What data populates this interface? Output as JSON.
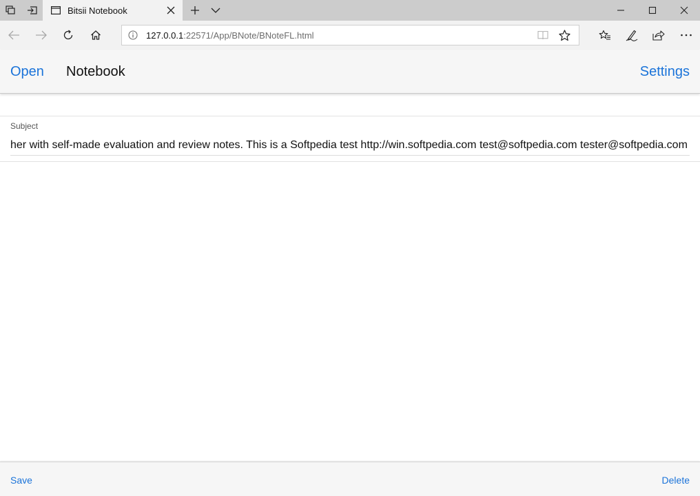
{
  "browser": {
    "tab": {
      "title": "Bitsii Notebook"
    },
    "address": {
      "url_host": "127.0.0.1",
      "url_rest": ":22571/App/BNote/BNoteFL.html"
    },
    "icons": [
      "tab-set-aside-icon",
      "tab-preview-icon",
      "page-icon",
      "close-icon",
      "plus-icon",
      "chevron-down-icon",
      "minimize-icon",
      "maximize-icon",
      "close-window-icon",
      "back-arrow-icon",
      "forward-arrow-icon",
      "refresh-icon",
      "home-icon",
      "info-icon",
      "reading-view-icon",
      "star-icon",
      "favorites-icon",
      "pen-icon",
      "share-icon",
      "more-icon"
    ]
  },
  "app": {
    "header": {
      "open_label": "Open",
      "title": "Notebook",
      "settings_label": "Settings"
    },
    "subject": {
      "label": "Subject",
      "value": "her with self-made evaluation and review notes. This is a Softpedia test http://win.softpedia.com test@softpedia.com tester@softpedia.com"
    },
    "footer": {
      "save_label": "Save",
      "delete_label": "Delete"
    }
  },
  "colors": {
    "accent": "#1a73d9",
    "titlebar": "#cccccc",
    "toolbar": "#f2f2f2",
    "appbar": "#f6f6f6"
  }
}
